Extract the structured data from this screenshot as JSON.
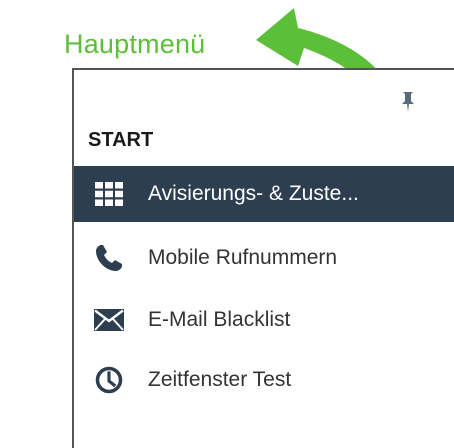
{
  "callout": {
    "label": "Hauptmenü",
    "color": "#5cbf3a"
  },
  "menu": {
    "heading": "START",
    "pin_icon": "pin-icon",
    "active_bg": "#2c3e50",
    "items": [
      {
        "label": "Avisierungs- & Zuste...",
        "icon": "grid-icon",
        "active": true
      },
      {
        "label": "Mobile Rufnummern",
        "icon": "phone-icon",
        "active": false
      },
      {
        "label": "E-Mail Blacklist",
        "icon": "envelope-icon",
        "active": false
      },
      {
        "label": "Zeitfenster Test",
        "icon": "clock-icon",
        "active": false
      }
    ]
  }
}
